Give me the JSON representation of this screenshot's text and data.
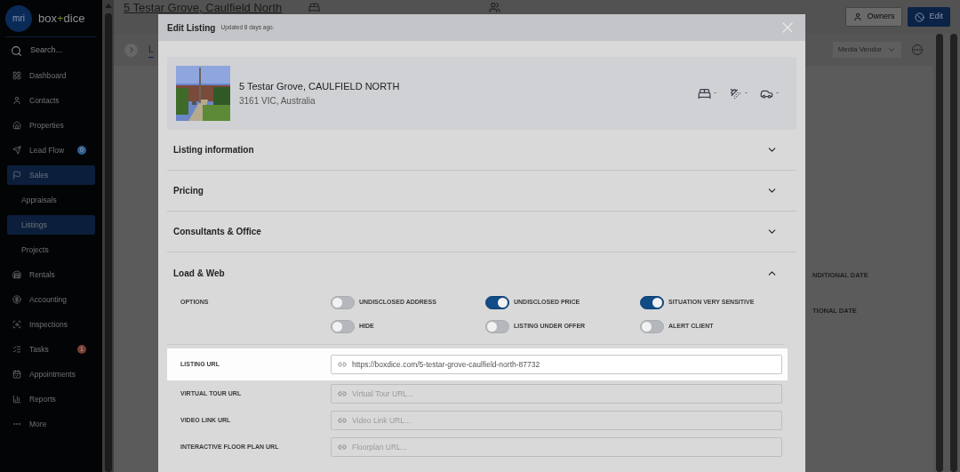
{
  "sidebar": {
    "logo_mark": "mri",
    "brand": {
      "left": "box",
      "plus": "+",
      "right": "dice"
    },
    "search": {
      "placeholder": "Search..."
    },
    "items": [
      {
        "label": "Dashboard",
        "selected": false
      },
      {
        "label": "Contacts",
        "selected": false
      },
      {
        "label": "Properties",
        "selected": false
      },
      {
        "label": "Lead Flow",
        "selected": false,
        "badge": {
          "text": "0",
          "color": "#2b5d8f"
        }
      },
      {
        "label": "Sales",
        "selected": true,
        "children": [
          {
            "label": "Appraisals",
            "selected": false
          },
          {
            "label": "Listings",
            "selected": true
          },
          {
            "label": "Projects",
            "selected": false
          }
        ]
      },
      {
        "label": "Rentals",
        "selected": false
      },
      {
        "label": "Accounting",
        "selected": false
      },
      {
        "label": "Inspections",
        "selected": false
      },
      {
        "label": "Tasks",
        "selected": false,
        "badge": {
          "text": "1",
          "color": "#7a3e33"
        }
      },
      {
        "label": "Appointments",
        "selected": false
      },
      {
        "label": "Reports",
        "selected": false
      },
      {
        "label": "More",
        "selected": false
      }
    ]
  },
  "header": {
    "title": "5 Testar Grove, Caulfield North",
    "buttons": [
      {
        "label": "Owners",
        "kind": "secondary"
      },
      {
        "label": "Edit",
        "kind": "primary"
      }
    ]
  },
  "subbar": {
    "tab": "L",
    "dropdown": "Media Vendor"
  },
  "background_labels": [
    "NDITIONAL DATE",
    "TIONAL DATE"
  ],
  "modal": {
    "title": "Edit Listing",
    "updated": "Updated 8 days ago.",
    "property": {
      "address": "5 Testar Grove, CAULFIELD NORTH",
      "locality": "3161 VIC, Australia",
      "features": [
        "-",
        "-",
        "-"
      ]
    },
    "sections": [
      {
        "title": "Listing information",
        "expanded": false
      },
      {
        "title": "Pricing",
        "expanded": false
      },
      {
        "title": "Consultants & Office",
        "expanded": false
      },
      {
        "title": "Load & Web",
        "expanded": true
      }
    ],
    "options": {
      "label": "OPTIONS",
      "toggles": [
        {
          "label": "UNDISCLOSED ADDRESS",
          "on": false
        },
        {
          "label": "UNDISCLOSED PRICE",
          "on": true
        },
        {
          "label": "SITUATION VERY SENSITIVE",
          "on": true
        },
        {
          "label": "HIDE",
          "on": false
        },
        {
          "label": "LISTING UNDER OFFER",
          "on": false
        },
        {
          "label": "ALERT CLIENT",
          "on": false
        }
      ]
    },
    "fields": [
      {
        "label": "LISTING URL",
        "value": "https://boxdice.com/5-testar-grove-caulfield-north-87732",
        "selected": true
      },
      {
        "label": "VIRTUAL TOUR URL",
        "placeholder": "Virtual Tour URL...",
        "selected": false
      },
      {
        "label": "VIDEO LINK URL",
        "placeholder": "Video Link URL...",
        "selected": false
      },
      {
        "label": "INTERACTIVE FLOOR PLAN URL",
        "placeholder": "Floorplan URL...",
        "selected": false
      }
    ]
  }
}
